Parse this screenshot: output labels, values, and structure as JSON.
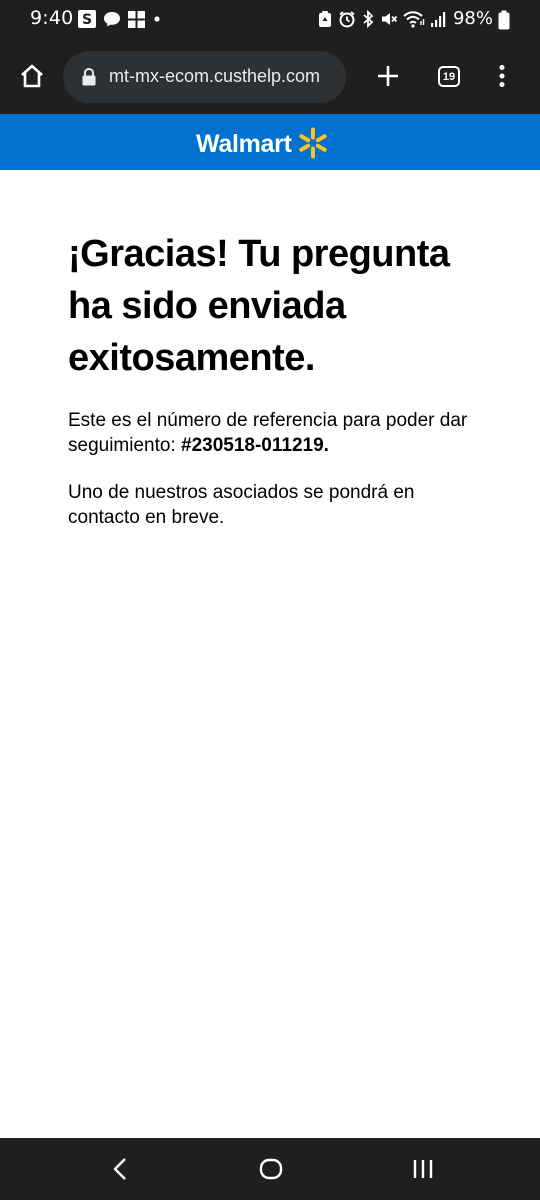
{
  "status_bar": {
    "time": "9:40",
    "battery": "98%",
    "icons_left": [
      "s-app-icon",
      "chat-bubble-icon",
      "gallery-icon",
      "dot-icon"
    ],
    "icons_right": [
      "recycle-icon",
      "alarm-icon",
      "bluetooth-icon",
      "mute-icon",
      "wifi-icon",
      "signal-icon",
      "battery-icon"
    ]
  },
  "browser": {
    "url": "mt-mx-ecom.custhelp.com",
    "tab_count": "19"
  },
  "brand": {
    "name": "Walmart",
    "color": "#0071ce",
    "spark_color": "#ffc220"
  },
  "content": {
    "title": "¡Gracias! Tu pregunta ha sido enviada exitosamente.",
    "reference_text": "Este es el número de referencia para poder dar seguimiento: ",
    "reference_number": "#230518-011219.",
    "contact_text": "Uno de nuestros asociados se pondrá en contacto en breve."
  }
}
